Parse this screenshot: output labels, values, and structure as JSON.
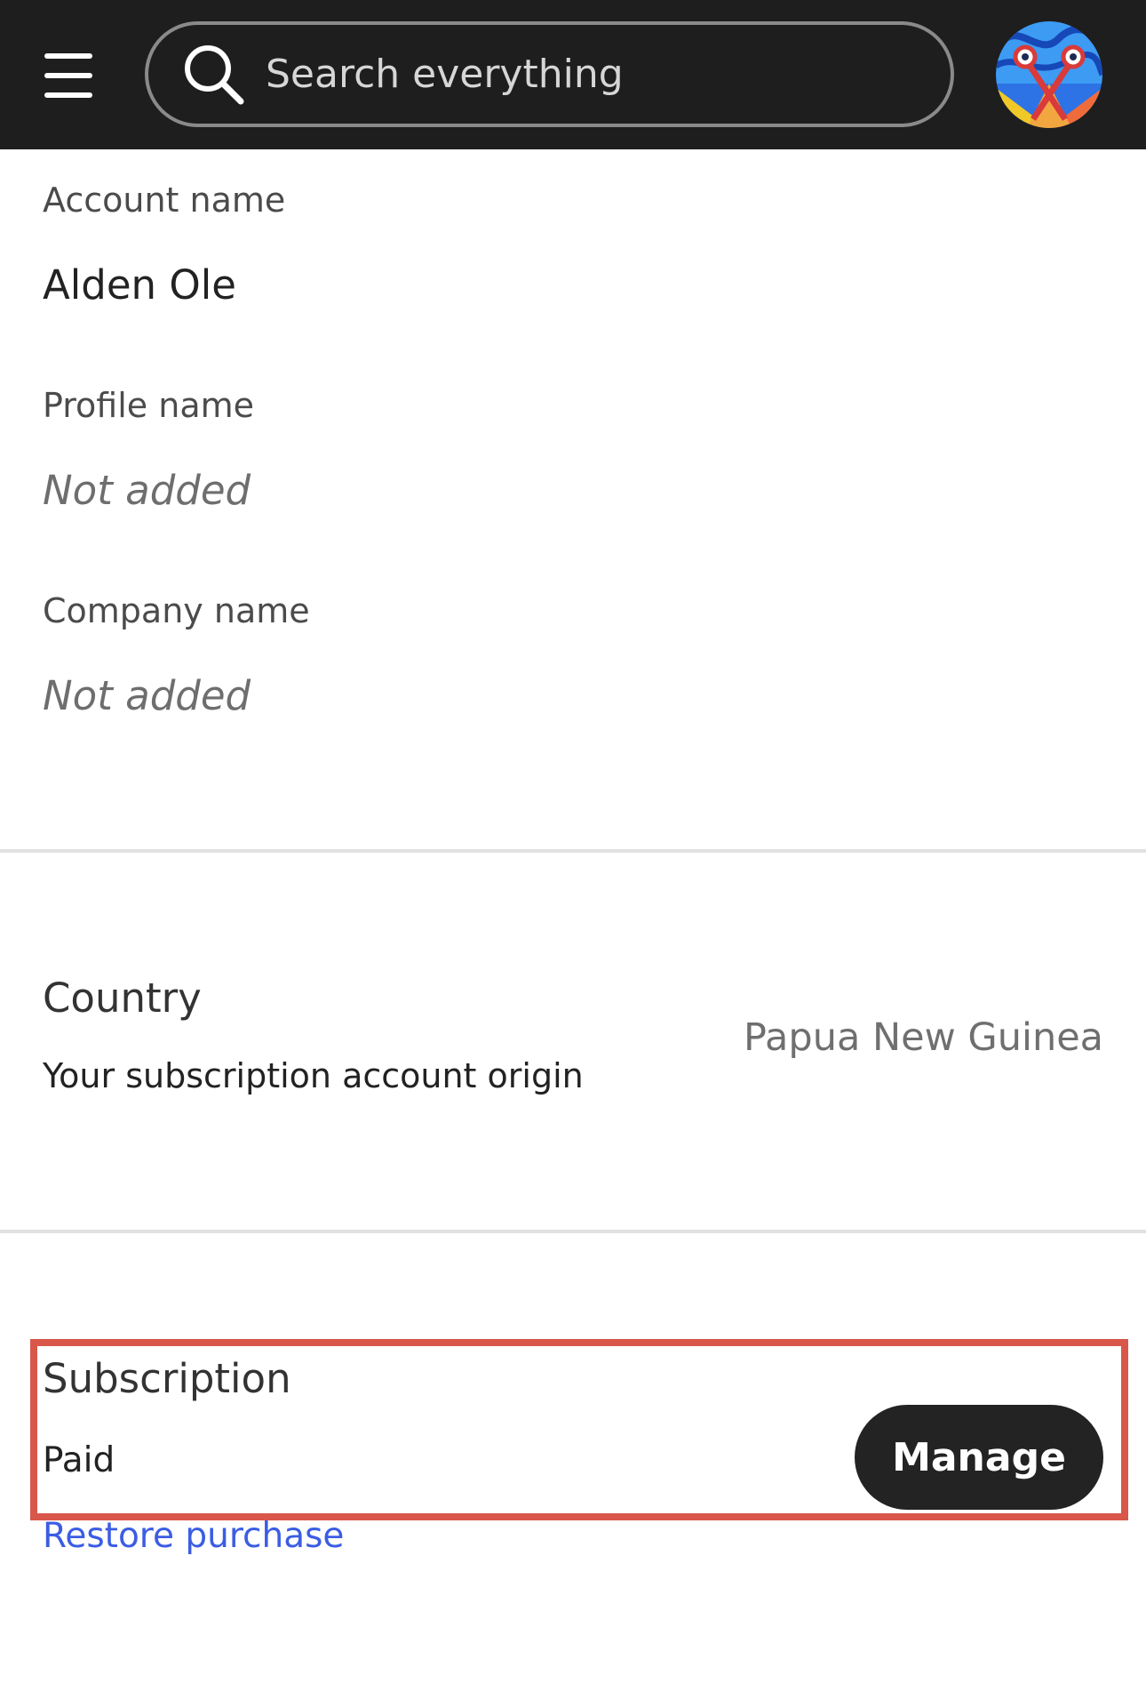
{
  "header": {
    "search_placeholder": "Search everything",
    "menu_icon": "hamburger-menu-icon",
    "search_icon": "search-icon",
    "avatar_icon": "avatar"
  },
  "profile": {
    "account_name_label": "Account name",
    "account_name_value": "Alden Ole",
    "profile_name_label": "Profile name",
    "profile_name_value": "Not added",
    "company_name_label": "Company name",
    "company_name_value": "Not added"
  },
  "country": {
    "title": "Country",
    "subtitle": "Your subscription account origin",
    "value": "Papua New Guinea"
  },
  "subscription": {
    "title": "Subscription",
    "status": "Paid",
    "manage_label": "Manage",
    "restore_label": "Restore purchase"
  },
  "colors": {
    "topbar": "#1e1e1e",
    "highlight_border": "#d9564a",
    "link": "#3b5de3"
  }
}
